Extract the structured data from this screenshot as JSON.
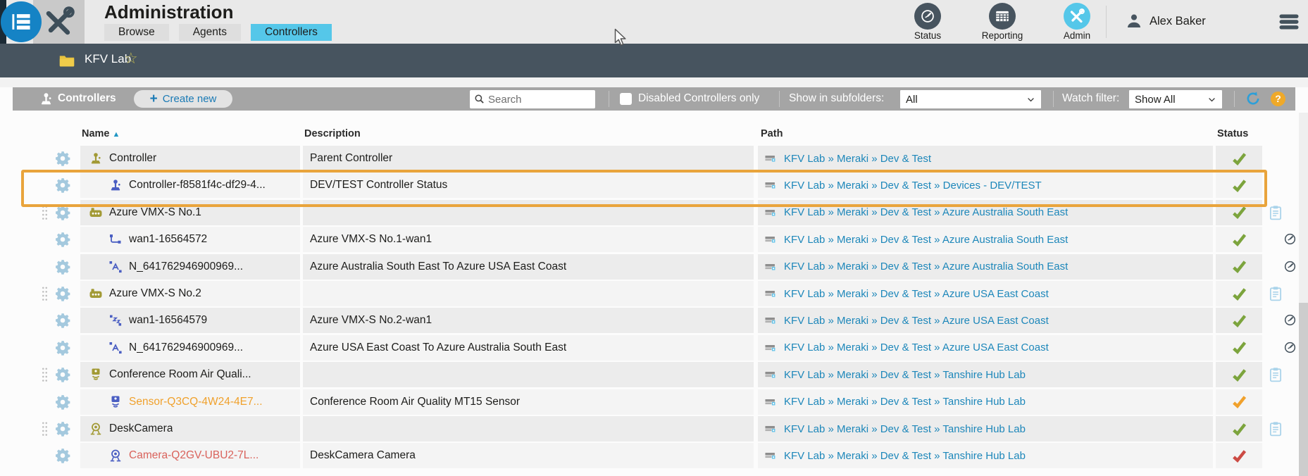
{
  "header": {
    "title": "Administration",
    "tabs": [
      {
        "label": "Browse",
        "active": false
      },
      {
        "label": "Agents",
        "active": false
      },
      {
        "label": "Controllers",
        "active": true
      }
    ],
    "nav": [
      {
        "label": "Status",
        "icon": "gauge-icon"
      },
      {
        "label": "Reporting",
        "icon": "report-table-icon"
      },
      {
        "label": "Admin",
        "icon": "crossed-tools-icon",
        "active": true
      }
    ],
    "user": "Alex Baker"
  },
  "breadcrumb": {
    "location": "KFV Lab"
  },
  "toolbar": {
    "section": "Controllers",
    "create": "Create new",
    "search_placeholder": "Search",
    "disabled_only": "Disabled Controllers only",
    "subfolders_label": "Show in subfolders:",
    "subfolders_value": "All",
    "watch_label": "Watch filter:",
    "watch_value": "Show All"
  },
  "table": {
    "columns": {
      "name": "Name",
      "description": "Description",
      "path": "Path",
      "status": "Status"
    },
    "rows": [
      {
        "name": "Controller",
        "icon": "joystick",
        "tone": "olive",
        "indent": false,
        "drag": false,
        "gauge": false,
        "name_tone": "default",
        "description": "Parent Controller",
        "path": "KFV Lab » Meraki » Dev & Test",
        "status": "ok",
        "clipboard": false,
        "highlighted": false
      },
      {
        "name": "Controller-f8581f4c-df29-4...",
        "icon": "joystick",
        "tone": "blue",
        "indent": true,
        "drag": false,
        "gauge": false,
        "name_tone": "default",
        "description": "DEV/TEST Controller Status",
        "path": "KFV Lab » Meraki » Dev & Test » Devices - DEV/TEST",
        "status": "ok",
        "clipboard": false,
        "highlighted": true
      },
      {
        "name": "Azure VMX-S No.1",
        "icon": "vmx",
        "tone": "olive",
        "indent": false,
        "drag": true,
        "gauge": false,
        "name_tone": "default",
        "description": "",
        "path": "KFV Lab » Meraki » Dev & Test » Azure Australia South East",
        "status": "ok",
        "clipboard": true,
        "highlighted": false
      },
      {
        "name": "wan1-16564572",
        "icon": "iface",
        "tone": "blue",
        "indent": true,
        "drag": false,
        "gauge": true,
        "name_tone": "default",
        "description": "Azure VMX-S No.1-wan1",
        "path": "KFV Lab » Meraki » Dev & Test » Azure Australia South East",
        "status": "ok",
        "clipboard": false,
        "highlighted": false
      },
      {
        "name": "N_641762946900969...",
        "icon": "tunnel",
        "tone": "blue",
        "indent": true,
        "drag": false,
        "gauge": true,
        "name_tone": "default",
        "description": "Azure Australia South East To Azure USA East Coast",
        "path": "KFV Lab » Meraki » Dev & Test » Azure Australia South East",
        "status": "ok",
        "clipboard": false,
        "highlighted": false
      },
      {
        "name": "Azure VMX-S No.2",
        "icon": "vmx",
        "tone": "olive",
        "indent": false,
        "drag": true,
        "gauge": false,
        "name_tone": "default",
        "description": "",
        "path": "KFV Lab » Meraki » Dev & Test » Azure USA East Coast",
        "status": "ok",
        "clipboard": true,
        "highlighted": false
      },
      {
        "name": "wan1-16564579",
        "icon": "iface-z",
        "tone": "blue",
        "indent": true,
        "drag": false,
        "gauge": true,
        "name_tone": "default",
        "description": "Azure VMX-S No.2-wan1",
        "path": "KFV Lab » Meraki » Dev & Test » Azure USA East Coast",
        "status": "ok",
        "clipboard": false,
        "highlighted": false
      },
      {
        "name": "N_641762946900969...",
        "icon": "tunnel",
        "tone": "blue",
        "indent": true,
        "drag": false,
        "gauge": true,
        "name_tone": "default",
        "description": "Azure USA East Coast To Azure Australia South East",
        "path": "KFV Lab » Meraki » Dev & Test » Azure USA East Coast",
        "status": "ok",
        "clipboard": false,
        "highlighted": false
      },
      {
        "name": "Conference Room Air Quali...",
        "icon": "sensor",
        "tone": "olive",
        "indent": false,
        "drag": true,
        "gauge": false,
        "name_tone": "default",
        "description": "",
        "path": "KFV Lab » Meraki » Dev & Test » Tanshire Hub Lab",
        "status": "ok",
        "clipboard": true,
        "highlighted": false
      },
      {
        "name": "Sensor-Q3CQ-4W24-4E7...",
        "icon": "sensor",
        "tone": "blue",
        "indent": true,
        "drag": false,
        "gauge": false,
        "name_tone": "warning",
        "description": "Conference Room Air Quality MT15 Sensor",
        "path": "KFV Lab » Meraki » Dev & Test » Tanshire Hub Lab",
        "status": "warning",
        "clipboard": false,
        "highlighted": false
      },
      {
        "name": "DeskCamera",
        "icon": "camera",
        "tone": "olive",
        "indent": false,
        "drag": true,
        "gauge": false,
        "name_tone": "default",
        "description": "",
        "path": "KFV Lab » Meraki » Dev & Test » Tanshire Hub Lab",
        "status": "ok",
        "clipboard": true,
        "highlighted": false
      },
      {
        "name": "Camera-Q2GV-UBU2-7L...",
        "icon": "camera",
        "tone": "blue",
        "indent": true,
        "drag": false,
        "gauge": false,
        "name_tone": "error",
        "description": "DeskCamera Camera",
        "path": "KFV Lab » Meraki » Dev & Test » Tanshire Hub Lab",
        "status": "error",
        "clipboard": false,
        "highlighted": false
      }
    ]
  },
  "colors": {
    "accent_cyan": "#55c7e9",
    "link_blue": "#1d87ba",
    "device_olive": "#a29a35",
    "device_blue": "#4a5ec2",
    "status_ok": "#7ca43d",
    "status_warning": "#f0a12c",
    "status_error": "#cc4b44",
    "highlight_orange": "#e9a43c",
    "bar_dark_slate": "#47545f",
    "toolbar_gray": "#a5a5a5"
  }
}
